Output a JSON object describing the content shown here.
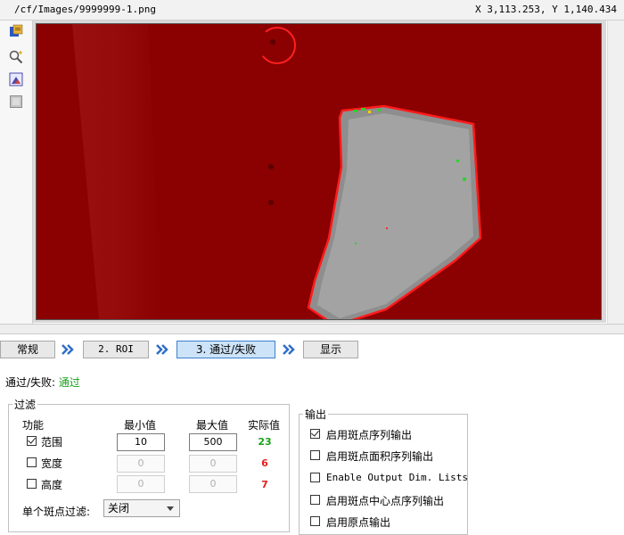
{
  "window": {
    "path": "/cf/Images/9999999-1.png",
    "coords": "X 3,113.253,   Y 1,140.434"
  },
  "toolbar": {
    "icons": [
      "image-file-icon",
      "zoom-icon",
      "image-icon",
      "gray-box-icon"
    ]
  },
  "wizard": {
    "steps": [
      "常规",
      "2. ROI",
      "3. 通过/失败",
      "显示"
    ],
    "active_step": "3. 通过/失败"
  },
  "status": {
    "label": "通过/失败:",
    "value": "通过",
    "value_color": "#1aa11a"
  },
  "filter": {
    "title": "过滤",
    "col_function": "功能",
    "col_min": "最小值",
    "col_max": "最大值",
    "col_actual": "实际值",
    "rows": [
      {
        "label": "范围",
        "checked": true,
        "min": "10",
        "max": "500",
        "actual": "23",
        "actual_color": "#1aa11a"
      },
      {
        "label": "宽度",
        "checked": false,
        "min": "0",
        "max": "0",
        "actual": "6",
        "actual_color": "#e02020"
      },
      {
        "label": "高度",
        "checked": false,
        "min": "0",
        "max": "0",
        "actual": "7",
        "actual_color": "#e02020"
      }
    ],
    "single_blob_label": "单个斑点过滤:",
    "single_blob_value": "关闭"
  },
  "output": {
    "title": "输出",
    "options": [
      {
        "label": "启用斑点序列输出",
        "checked": true
      },
      {
        "label": "启用斑点面积序列输出",
        "checked": false
      },
      {
        "label": "Enable Output Dim. Lists",
        "checked": false
      },
      {
        "label": "启用斑点中心点序列输出",
        "checked": false
      },
      {
        "label": "启用原点输出",
        "checked": false
      }
    ]
  },
  "colors": {
    "overlay_red": "#8b0000",
    "accent_blue": "#3c7fd1",
    "pass_green": "#1aa11a",
    "fail_red": "#e02020"
  }
}
